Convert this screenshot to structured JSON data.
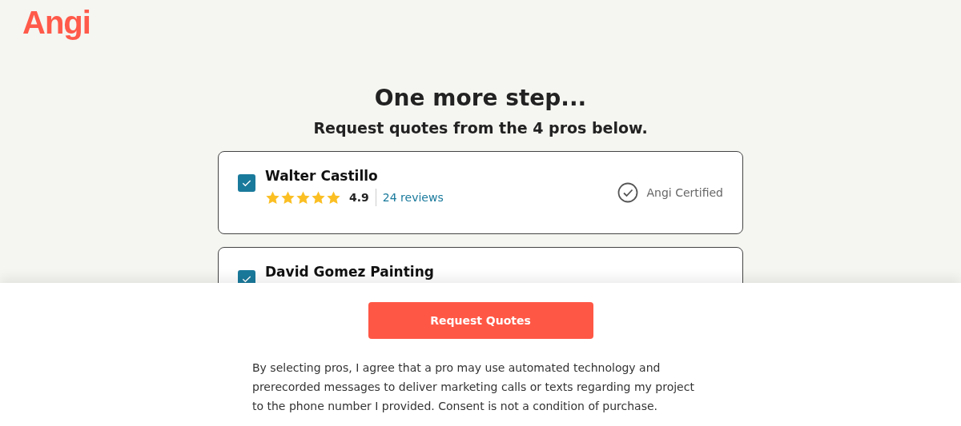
{
  "logo": "Angi",
  "title": "One more step...",
  "subtitle": "Request quotes from the 4 pros below.",
  "pros": [
    {
      "name": "Walter Castillo",
      "checked": true,
      "stars": 5,
      "rating": "4.9",
      "reviews": "24 reviews",
      "certified": "Angi Certified"
    },
    {
      "name": "David Gomez Painting",
      "checked": true
    }
  ],
  "footer": {
    "button": "Request Quotes",
    "consent": "By selecting pros, I agree that a pro may use automated technology and prerecorded messages to deliver marketing calls or texts regarding my project to the phone number I provided. Consent is not a condition of purchase."
  }
}
